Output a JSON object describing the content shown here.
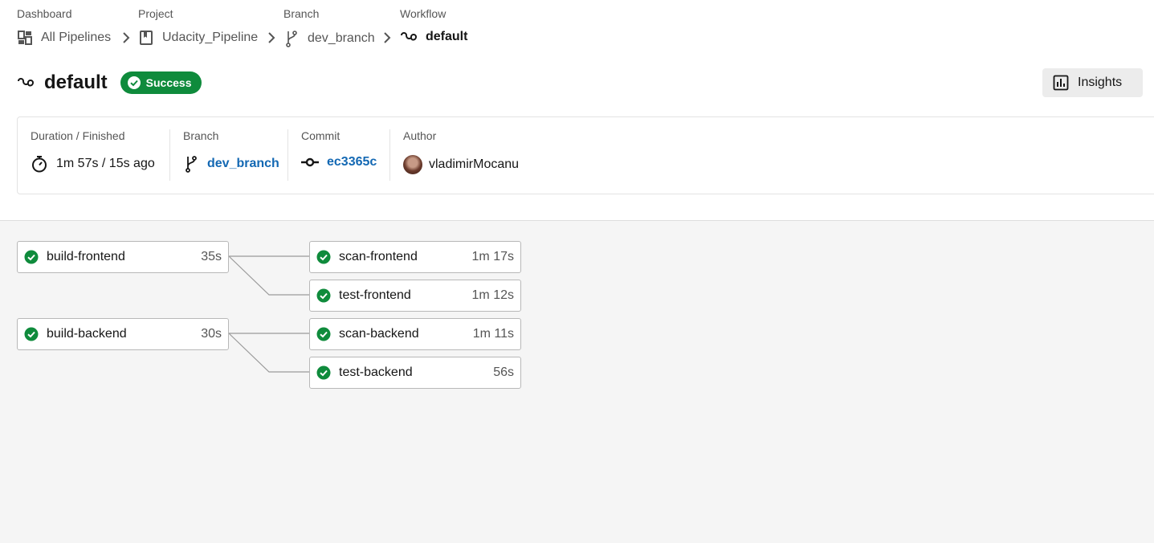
{
  "breadcrumb": [
    {
      "label": "Dashboard",
      "value": "All Pipelines",
      "icon": "dashboard-icon"
    },
    {
      "label": "Project",
      "value": "Udacity_Pipeline",
      "icon": "bookmark-icon"
    },
    {
      "label": "Branch",
      "value": "dev_branch",
      "icon": "branch-icon"
    },
    {
      "label": "Workflow",
      "value": "default",
      "icon": "workflow-icon"
    }
  ],
  "workflow": {
    "title": "default",
    "status": "Success",
    "status_color": "#0f8b3c"
  },
  "insights_label": "Insights",
  "info": {
    "duration_label": "Duration / Finished",
    "duration_value": "1m 57s / 15s ago",
    "branch_label": "Branch",
    "branch_value": "dev_branch",
    "commit_label": "Commit",
    "commit_value": "ec3365c",
    "author_label": "Author",
    "author_value": "vladimirMocanu"
  },
  "jobs": [
    {
      "name": "build-frontend",
      "duration": "35s",
      "status": "success"
    },
    {
      "name": "scan-frontend",
      "duration": "1m 17s",
      "status": "success"
    },
    {
      "name": "test-frontend",
      "duration": "1m 12s",
      "status": "success"
    },
    {
      "name": "build-backend",
      "duration": "30s",
      "status": "success"
    },
    {
      "name": "scan-backend",
      "duration": "1m 11s",
      "status": "success"
    },
    {
      "name": "test-backend",
      "duration": "56s",
      "status": "success"
    }
  ],
  "colors": {
    "success": "#0f8b3c",
    "link": "#1368b3"
  }
}
